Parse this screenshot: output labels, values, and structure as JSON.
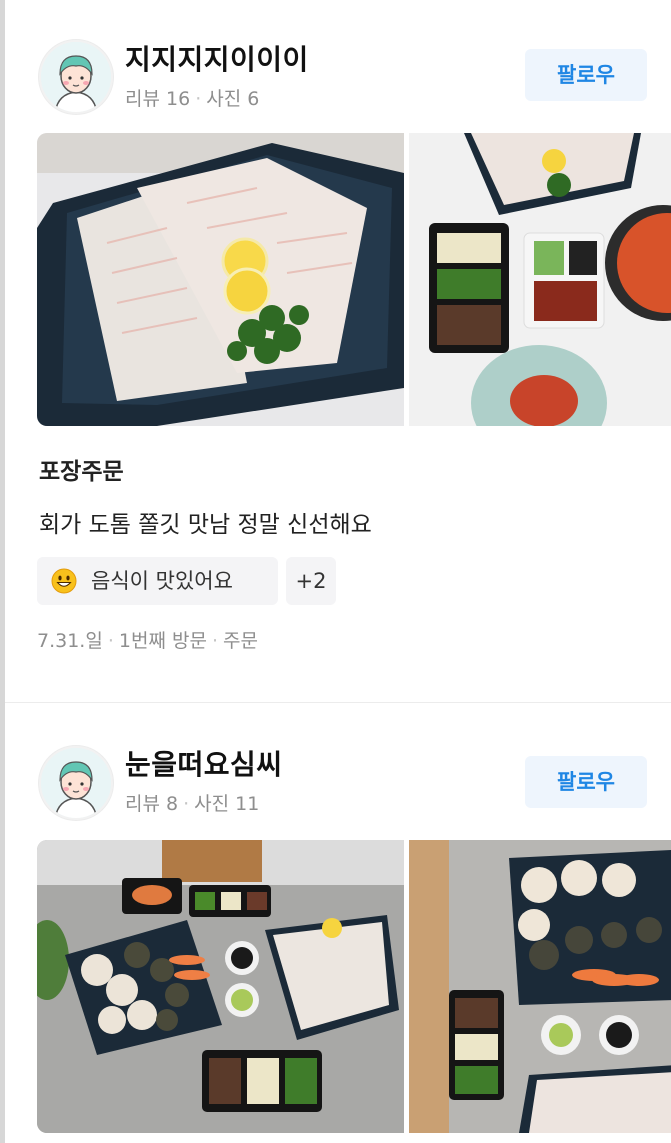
{
  "reviews": [
    {
      "nickname": "지지지지이이이",
      "review_label": "리뷰",
      "review_count": "16",
      "photo_label": "사진",
      "photo_count": "6",
      "follow_label": "팔로우",
      "order_type": "포장주문",
      "text": "회가 도톰 쫄깃 맛남 정말 신선해요",
      "tag_label": "음식이 맛있어요",
      "tag_more": "+2",
      "visit_date": "7.31.일",
      "visit_count": "1번째 방문",
      "visit_type": "주문"
    },
    {
      "nickname": "눈을떠요심씨",
      "review_label": "리뷰",
      "review_count": "8",
      "photo_label": "사진",
      "photo_count": "11",
      "follow_label": "팔로우"
    }
  ],
  "colors": {
    "accent": "#1f86e4",
    "follow_bg": "#eef5fd",
    "meta_gray": "#8e8e8e",
    "tag_bg": "#f4f4f6"
  },
  "icons": {
    "avatar": "default-profile-avatar",
    "tag_emoji": "smiley-emoji-icon"
  }
}
